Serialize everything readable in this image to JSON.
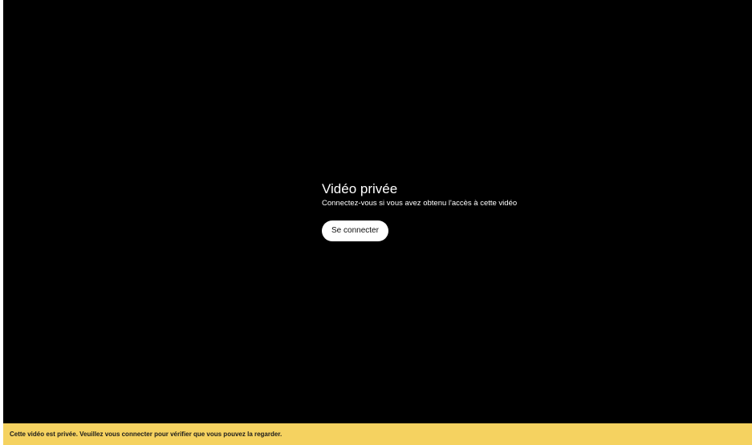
{
  "player": {
    "error_title": "Vidéo privée",
    "error_subtitle": "Connectez-vous si vous avez obtenu l'accès à cette vidéo",
    "signin_label": "Se connecter"
  },
  "notice_bar": {
    "text": "Cette vidéo est privée. Veuillez vous connecter pour vérifier que vous pouvez la regarder."
  },
  "colors": {
    "player_background": "#000000",
    "notice_background": "#f5d260",
    "button_background": "#ffffff"
  }
}
